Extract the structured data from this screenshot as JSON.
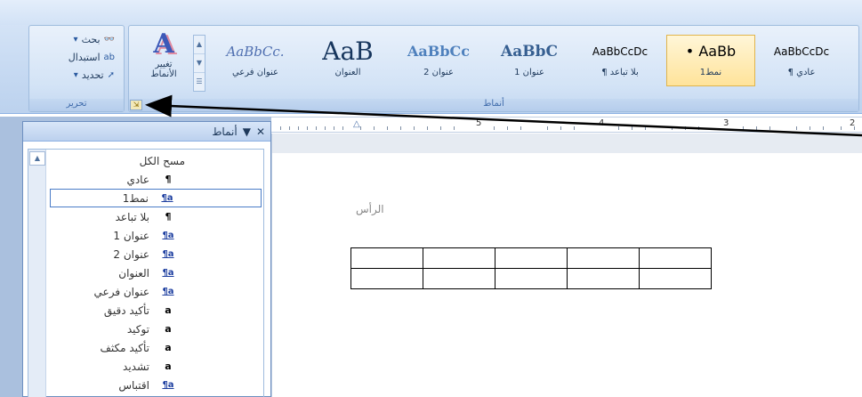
{
  "ribbon": {
    "editing": {
      "find": "بحث",
      "replace": "استبدال",
      "select": "تحديد",
      "group_label": "تحرير"
    },
    "styles": {
      "change_styles_line1": "تغيير",
      "change_styles_line2": "الأنماط",
      "group_label": "أنماط",
      "gallery": [
        {
          "preview": "AaBbCc.",
          "name": "عنوان فرعي"
        },
        {
          "preview": "AaB",
          "name": "العنوان"
        },
        {
          "preview": "AaBbCc",
          "name": "عنوان 2"
        },
        {
          "preview": "AaBbC",
          "name": "عنوان 1"
        },
        {
          "preview": "AaBbCcDc",
          "name": "¶ بلا تباعد"
        },
        {
          "preview": "• AaBb",
          "name": "نمط1",
          "selected": true
        },
        {
          "preview": "AaBbCcDc",
          "name": "¶ عادي"
        }
      ]
    }
  },
  "ruler": {
    "numbers": [
      "5",
      "4",
      "3",
      "2"
    ]
  },
  "document": {
    "header_label": "الرأس",
    "table": {
      "rows": 2,
      "cols": 5
    }
  },
  "styles_pane": {
    "title": "أنماط",
    "items": [
      {
        "label": "مسح الكل",
        "glyph": ""
      },
      {
        "label": "عادي",
        "glyph": "¶"
      },
      {
        "label": "نمط1",
        "glyph": "¶a",
        "selected": true
      },
      {
        "label": "بلا تباعد",
        "glyph": "¶"
      },
      {
        "label": "عنوان 1",
        "glyph": "¶a"
      },
      {
        "label": "عنوان 2",
        "glyph": "¶a"
      },
      {
        "label": "العنوان",
        "glyph": "¶a"
      },
      {
        "label": "عنوان فرعي",
        "glyph": "¶a"
      },
      {
        "label": "تأكيد دقيق",
        "glyph": "a"
      },
      {
        "label": "توكيد",
        "glyph": "a"
      },
      {
        "label": "تأكيد مكثف",
        "glyph": "a"
      },
      {
        "label": "تشديد",
        "glyph": "a"
      },
      {
        "label": "اقتباس",
        "glyph": "¶a"
      }
    ]
  },
  "colors": {
    "accent": "#3c58b8",
    "ribbon": "#c7daf2",
    "selection": "#ffe39a"
  }
}
